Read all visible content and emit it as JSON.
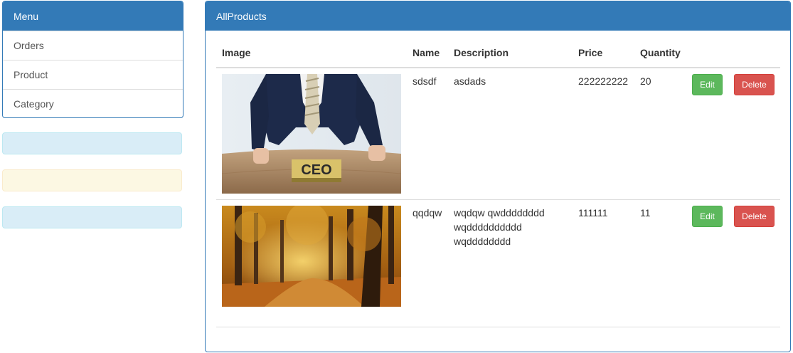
{
  "sidebar": {
    "heading": "Menu",
    "items": [
      {
        "label": "Orders"
      },
      {
        "label": "Product"
      },
      {
        "label": "Category"
      }
    ]
  },
  "main": {
    "heading": "AllProducts",
    "columns": {
      "image": "Image",
      "name": "Name",
      "description": "Description",
      "price": "Price",
      "quantity": "Quantity"
    },
    "rows": [
      {
        "image_icon": "ceo-photo",
        "image_label": "CEO",
        "name": "sdsdf",
        "description": [
          "asdads"
        ],
        "price": "222222222",
        "quantity": "20",
        "edit_label": "Edit",
        "delete_label": "Delete"
      },
      {
        "image_icon": "autumn-forest-photo",
        "name": "qqdqw",
        "description": [
          "wqdqw qwdddddddd",
          "wqdddddddddd",
          "wqdddddddd"
        ],
        "price": "111111",
        "quantity": "11",
        "edit_label": "Edit",
        "delete_label": "Delete"
      }
    ]
  },
  "colors": {
    "primary": "#337ab7",
    "success": "#5cb85c",
    "danger": "#d9534f",
    "info_bg": "#d9edf7",
    "warning_bg": "#fcf8e3"
  }
}
